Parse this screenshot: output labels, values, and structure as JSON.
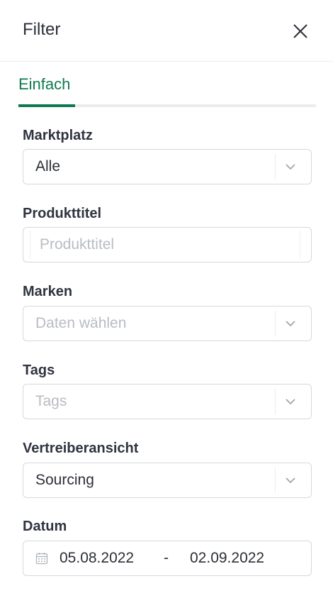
{
  "panel": {
    "title": "Filter"
  },
  "tabs": [
    {
      "label": "Einfach"
    }
  ],
  "filters": {
    "marktplatz": {
      "label": "Marktplatz",
      "value": "Alle"
    },
    "produkttitel": {
      "label": "Produkttitel",
      "placeholder": "Produkttitel"
    },
    "marken": {
      "label": "Marken",
      "placeholder": "Daten wählen"
    },
    "tags": {
      "label": "Tags",
      "placeholder": "Tags"
    },
    "vertreiberansicht": {
      "label": "Vertreiberansicht",
      "value": "Sourcing"
    },
    "datum": {
      "label": "Datum",
      "from": "05.08.2022",
      "separator": "-",
      "to": "02.09.2022"
    }
  },
  "icons": {
    "close": "close-icon",
    "chevron": "chevron-down-icon",
    "calendar": "calendar-icon"
  },
  "colors": {
    "accent": "#0f7a50",
    "text": "#2f3440",
    "placeholder": "#b9bcc2",
    "border": "#d6d8dc"
  }
}
